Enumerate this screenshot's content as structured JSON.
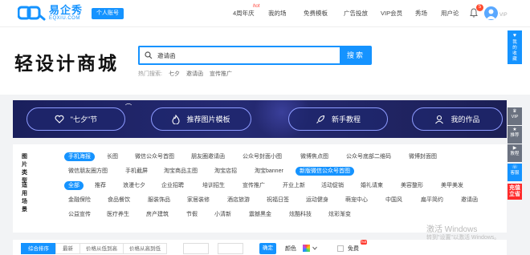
{
  "brand": {
    "cn": "易企秀",
    "en": "EQXIU.COM",
    "account_badge": "个人账号"
  },
  "nav": {
    "items": [
      "4周年庆",
      "我的场景",
      "免费模板",
      "广告投放",
      "VIP会员",
      "秀场",
      "用户论坛"
    ],
    "hot_label": "hot",
    "notification_count": "5",
    "vip_label": "VIP"
  },
  "header": {
    "title": "轻设计商城",
    "search_value": "邀请函",
    "search_button": "搜索",
    "hot_search_label": "热门搜索:",
    "hot_keywords": [
      "七夕",
      "邀请函",
      "宣传推广"
    ]
  },
  "banner": {
    "buttons": [
      "\"七夕\"节",
      "推荐图片模板",
      "新手教程",
      "我的作品"
    ]
  },
  "filters": {
    "type_label": "图片类型",
    "types_row1": [
      "手机海报",
      "长图",
      "微信公众号首图",
      "朋友圈邀请函",
      "公众号封面小图",
      "微博焦点图",
      "公众号底部二维码",
      "微博封面图"
    ],
    "types_row2": [
      "微信朋友圈方图",
      "手机截屏",
      "淘宝商品主图",
      "淘宝店招",
      "淘宝banner",
      "新版微信公众号首图"
    ],
    "active_type": "手机海报",
    "scene_label": "适用场景",
    "scenes_row1": [
      "全部",
      "推荐",
      "浪漫七夕",
      "企业招聘",
      "培训招生",
      "宣传推广",
      "开业上新",
      "活动促销",
      "婚礼请柬",
      "美容整形",
      "美甲美发"
    ],
    "scenes_row2": [
      "金融保险",
      "食品餐饮",
      "服装饰品",
      "家居装修",
      "酒店旅游",
      "祝福日签",
      "运动健身",
      "萌宠中心",
      "中国风",
      "扁平简约",
      "邀请函"
    ],
    "scenes_row3": [
      "公益宣传",
      "医疗养生",
      "房产建筑",
      "节假",
      "小清新",
      "震撼黑金",
      "炫酷科技",
      "炫彩渐变"
    ],
    "active_scene": "全部"
  },
  "sortbar": {
    "tabs": [
      "综合排序",
      "最新",
      "价格从低到高",
      "价格从高到低"
    ],
    "confirm": "确定",
    "color_label": "颜色",
    "free_label": "免费",
    "free_badge": "hot"
  },
  "sidebar": {
    "collect": "我的收藏",
    "vip": "VIP",
    "recommend": "推荐",
    "tutorial": "教程",
    "service": "客服",
    "recharge": "充值立省"
  },
  "watermark": {
    "line1": "激活 Windows",
    "line2": "转到\"设置\"以激活 Windows。"
  },
  "colors": {
    "accent": "#1593ff",
    "banner_bg": "#1f2468",
    "recharge_red": "#ff2b2b"
  }
}
